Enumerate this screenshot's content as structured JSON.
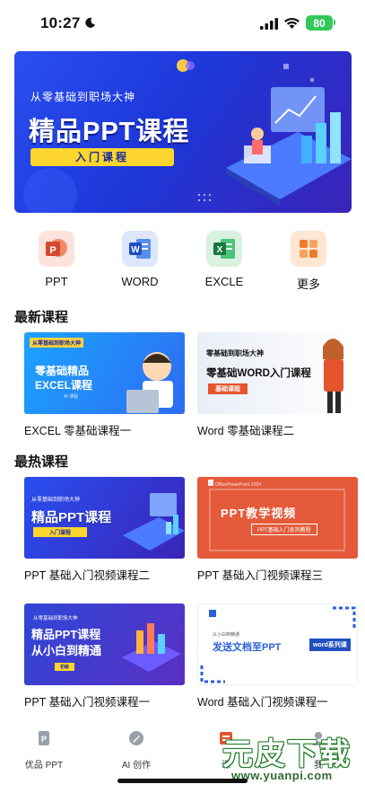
{
  "status_bar": {
    "time": "10:27",
    "battery": "80"
  },
  "banner": {
    "subtitle": "从零基础到职场大神",
    "title": "精品PPT课程",
    "button_label": "入门课程"
  },
  "categories": [
    {
      "label": "PPT",
      "color": "#e8613d"
    },
    {
      "label": "WORD",
      "color": "#2b5fd9"
    },
    {
      "label": "EXCLE",
      "color": "#22a055"
    },
    {
      "label": "更多",
      "color": "#f07b2a"
    }
  ],
  "sections": {
    "latest": "最新课程",
    "hottest": "最热课程"
  },
  "latest_courses": [
    {
      "title": "EXCEL 零基础课程一",
      "thumb_lines": [
        "从零基础到职场大神",
        "零基础精品",
        "EXCEL课程",
        "AI 课程"
      ]
    },
    {
      "title": "Word 零基础课程二",
      "thumb_lines": [
        "零基础到职场大神",
        "零基础WORD入门课程",
        "基础课程"
      ]
    }
  ],
  "hot_courses": [
    {
      "title": "PPT 基础入门视频课程二",
      "thumb_lines": [
        "从零基础到职场大神",
        "精品PPT课程",
        "入门课程"
      ]
    },
    {
      "title": "PPT 基础入门视频课程三",
      "thumb_lines": [
        "OfficePowerPoint 2024",
        "PPT教学视频",
        "PPT基础入门系列教程"
      ]
    },
    {
      "title": "PPT 基础入门视频课程一",
      "thumb_lines": [
        "从零基础到职场大神",
        "精品PPT课程",
        "从小白到精通",
        "初级"
      ]
    },
    {
      "title": "Word 基础入门视频课程一",
      "thumb_lines": [
        "从小白到精通",
        "发送文档至PPT",
        "word系列课"
      ]
    }
  ],
  "tabs": [
    {
      "label": "优品 PPT"
    },
    {
      "label": "AI 创作"
    },
    {
      "label": "课"
    },
    {
      "label": "我"
    }
  ],
  "watermark": {
    "main": "元皮下载",
    "url": "www.yuanpi.com"
  }
}
